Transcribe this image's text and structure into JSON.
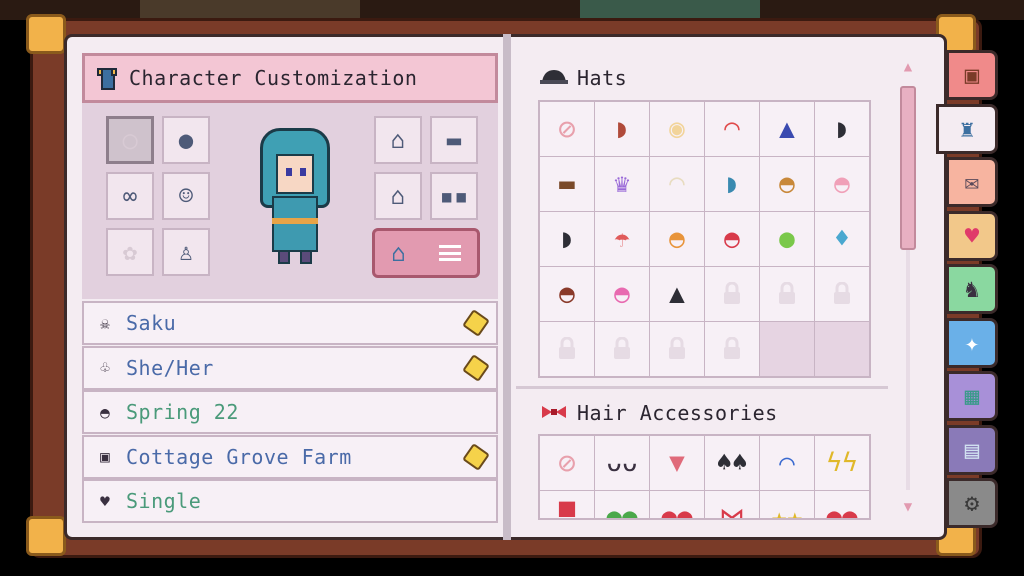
{
  "left_page": {
    "header": {
      "title": "Character Customization",
      "icon": "shirt-icon"
    },
    "slots_left": [
      {
        "name": "hat-slot",
        "glyph": "◯",
        "selected": true
      },
      {
        "name": "hairstyle-slot",
        "glyph": "●"
      },
      {
        "name": "hair-color-slot",
        "glyph": "∞"
      },
      {
        "name": "face-slot",
        "glyph": "☺"
      },
      {
        "name": "accessory-slot",
        "glyph": "✿"
      },
      {
        "name": "body-slot",
        "glyph": "♙"
      }
    ],
    "slots_right": [
      {
        "name": "top-slot",
        "glyph": "⌂"
      },
      {
        "name": "bottom-slot",
        "glyph": "▬"
      },
      {
        "name": "outerwear-slot",
        "glyph": "⌂"
      },
      {
        "name": "glasses-slot",
        "glyph": "▪▪"
      }
    ],
    "info": [
      {
        "icon": "skull-icon",
        "glyph": "☠",
        "text": "Saku",
        "color": "blue",
        "editable": true
      },
      {
        "icon": "pronoun-icon",
        "glyph": "♧",
        "text": "She/Her",
        "color": "blue",
        "editable": true
      },
      {
        "icon": "cake-icon",
        "glyph": "◓",
        "text": "Spring 22",
        "color": "green",
        "editable": false
      },
      {
        "icon": "backpack-icon",
        "glyph": "▣",
        "text": "Cottage Grove Farm",
        "color": "blue",
        "editable": true
      },
      {
        "icon": "heart-icon",
        "glyph": "♥",
        "text": "Single",
        "color": "green",
        "editable": false
      }
    ]
  },
  "right_page": {
    "hats_title": "Hats",
    "hair_acc_title": "Hair Accessories",
    "hats": [
      {
        "g": "⊘",
        "t": "none"
      },
      {
        "g": "◗",
        "c": "#b04a3a"
      },
      {
        "g": "◉",
        "c": "#f2d49a"
      },
      {
        "g": "◠",
        "c": "#e04a4a"
      },
      {
        "g": "▲",
        "c": "#3a4ab0"
      },
      {
        "g": "◗",
        "c": "#2e2e36"
      },
      {
        "g": "▬",
        "c": "#7a4a2a"
      },
      {
        "g": "♛",
        "c": "#9a6ad8"
      },
      {
        "g": "◠",
        "c": "#e8dcc0"
      },
      {
        "g": "◗",
        "c": "#3a8ab0"
      },
      {
        "g": "◓",
        "c": "#c8883a"
      },
      {
        "g": "◓",
        "c": "#f0a0b8"
      },
      {
        "g": "◗",
        "c": "#2e2e36"
      },
      {
        "g": "☂",
        "c": "#e05a5a"
      },
      {
        "g": "◓",
        "c": "#e8943a"
      },
      {
        "g": "◓",
        "c": "#d83a4a"
      },
      {
        "g": "●",
        "c": "#7ac84a"
      },
      {
        "g": "♦",
        "c": "#4aa8d0"
      },
      {
        "g": "◓",
        "c": "#8a3a2a"
      },
      {
        "g": "◓",
        "c": "#e86ab0"
      },
      {
        "g": "▲",
        "c": "#2e2e36"
      },
      {
        "g": "🔒",
        "t": "locked"
      },
      {
        "g": "🔒",
        "t": "locked"
      },
      {
        "g": "🔒",
        "t": "locked"
      },
      {
        "g": "🔒",
        "t": "locked"
      },
      {
        "g": "🔒",
        "t": "locked"
      },
      {
        "g": "🔒",
        "t": "locked"
      },
      {
        "g": "🔒",
        "t": "locked"
      },
      {
        "g": "",
        "t": "empty"
      },
      {
        "g": "",
        "t": "empty"
      }
    ],
    "hair_accessories": [
      {
        "g": "⊘",
        "t": "none"
      },
      {
        "g": "ᴗᴗ",
        "c": "#3a3040"
      },
      {
        "g": "▼",
        "c": "#e06a7a"
      },
      {
        "g": "♠♠",
        "c": "#2e2e36"
      },
      {
        "g": "⌒",
        "c": "#3a6ad0"
      },
      {
        "g": "ϟϟ",
        "c": "#e0b82a"
      },
      {
        "g": "▀",
        "c": "#d83a4a"
      },
      {
        "g": "●●",
        "c": "#4aa84a"
      },
      {
        "g": "●●",
        "c": "#d83a4a"
      },
      {
        "g": "⋈",
        "c": "#d83a4a"
      },
      {
        "g": "★★",
        "c": "#e0b82a"
      },
      {
        "g": "●●",
        "c": "#d83a4a"
      }
    ]
  },
  "tabs": [
    {
      "name": "tab-backpack",
      "glyph": "▣",
      "bg": "#f08a8a",
      "c": "#7a3b28"
    },
    {
      "name": "tab-character",
      "glyph": "♜",
      "bg": "#f4ecf2",
      "c": "#3c6fa0",
      "active": true
    },
    {
      "name": "tab-mail",
      "glyph": "✉",
      "bg": "#f7b4a0",
      "c": "#5a4a5a"
    },
    {
      "name": "tab-relationships",
      "glyph": "♥",
      "bg": "#f2c88a",
      "c": "#e03a6a"
    },
    {
      "name": "tab-animals",
      "glyph": "♞",
      "bg": "#8ad8a0",
      "c": "#3a3040"
    },
    {
      "name": "tab-skills",
      "glyph": "✦",
      "bg": "#6ab0e8",
      "c": "#fff"
    },
    {
      "name": "tab-map",
      "glyph": "▦",
      "bg": "#a890d8",
      "c": "#3a9a8a"
    },
    {
      "name": "tab-journal",
      "glyph": "▤",
      "bg": "#8a7ab8",
      "c": "#d0e0f0"
    },
    {
      "name": "tab-settings",
      "glyph": "⚙",
      "bg": "#8a8a8a",
      "c": "#3a3a3a"
    }
  ]
}
